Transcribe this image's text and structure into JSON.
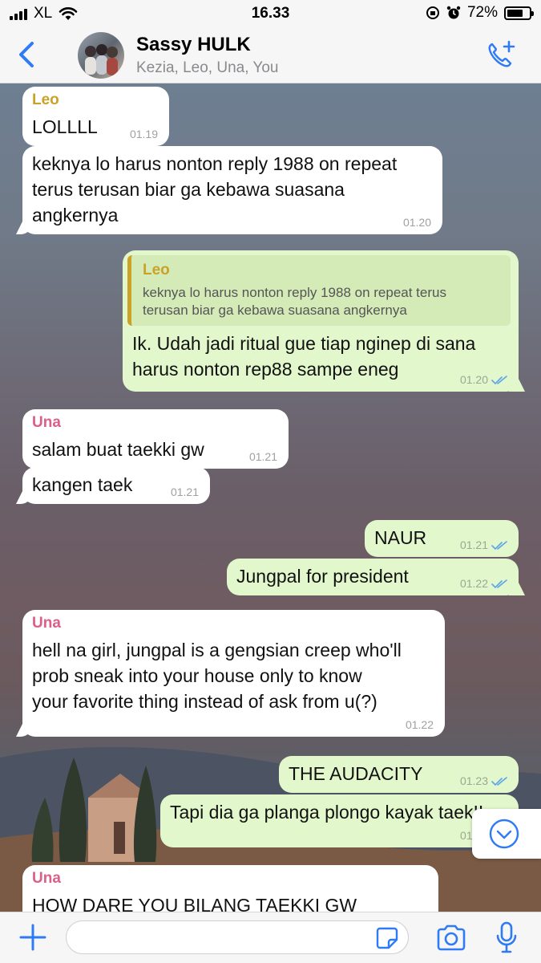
{
  "status": {
    "carrier": "XL",
    "time": "16.33",
    "battery": "72%",
    "battery_level": 0.72
  },
  "header": {
    "back_label": "",
    "title": "Sassy HULK",
    "members": "Kezia, Leo, Una, You"
  },
  "colors": {
    "accent": "#2f7bf5",
    "outgoing": "#e2f7cb",
    "incoming": "#ffffff",
    "leo": "#c9a227",
    "una": "#d9608a"
  },
  "messages": [
    {
      "dir": "in",
      "sender": "Leo",
      "lines": [
        "LOLLLL"
      ],
      "time": "01.19"
    },
    {
      "dir": "in",
      "lines": [
        "keknya lo harus nonton reply 1988 on repeat",
        "terus terusan biar ga kebawa suasana",
        "angkernya"
      ],
      "time": "01.20"
    },
    {
      "dir": "out",
      "quote_name": "Leo",
      "quote_lines": [
        "keknya lo harus nonton reply 1988 on repeat terus",
        "terusan biar ga kebawa suasana angkernya"
      ],
      "lines": [
        "Ik. Udah jadi ritual gue tiap nginep di sana",
        "harus nonton rep88 sampe eneg"
      ],
      "time": "01.20"
    },
    {
      "dir": "in",
      "sender": "Una",
      "lines": [
        "salam buat taekki gw"
      ],
      "time": "01.21"
    },
    {
      "dir": "in",
      "lines": [
        "kangen taek"
      ],
      "time": "01.21"
    },
    {
      "dir": "out",
      "lines": [
        "NAUR"
      ],
      "time": "01.21"
    },
    {
      "dir": "out",
      "lines": [
        "Jungpal for president"
      ],
      "time": "01.22"
    },
    {
      "dir": "in",
      "sender": "Una",
      "lines": [
        "hell na girl, jungpal is a gengsian creep who'll",
        "prob sneak into your house only to know",
        "your favorite thing instead of ask from u(?)"
      ],
      "time": "01.22"
    },
    {
      "dir": "out",
      "lines": [
        "THE AUDACITY"
      ],
      "time": "01.23"
    },
    {
      "dir": "out",
      "lines": [
        "Tapi dia ga planga plongo kayak taek!!"
      ],
      "time": "01.23"
    },
    {
      "dir": "in",
      "sender": "Una",
      "lines": [
        "HOW DARE YOU BILANG TAEKKI GW"
      ],
      "time": ""
    }
  ],
  "composer": {
    "placeholder": ""
  }
}
